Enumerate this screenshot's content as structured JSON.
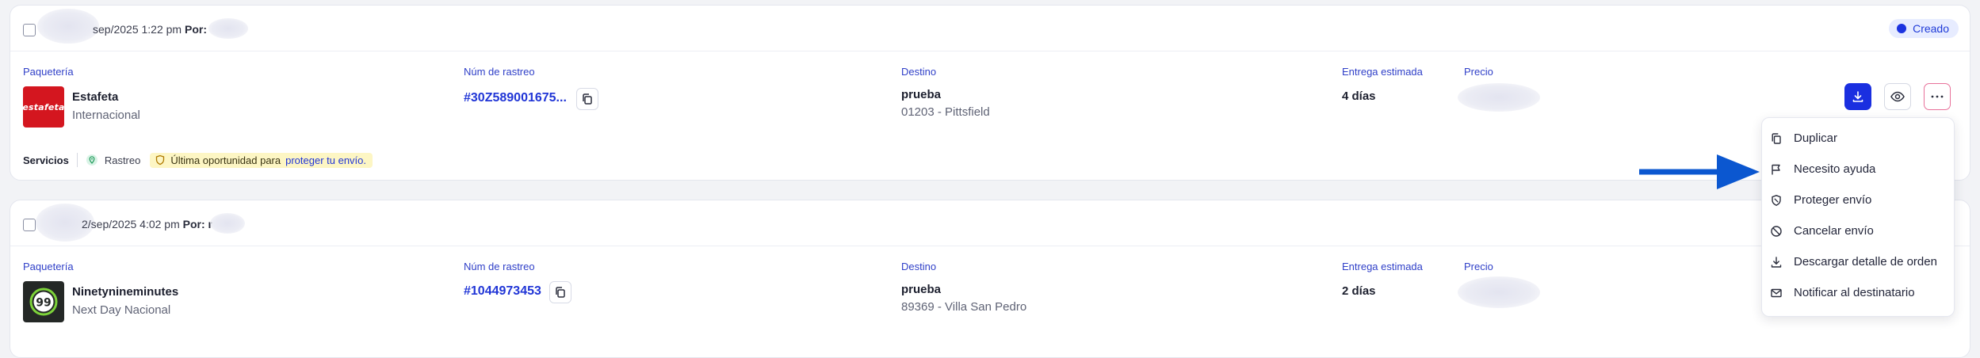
{
  "columns": {
    "carrier": "Paquetería",
    "tracking": "Núm de rastreo",
    "destination": "Destino",
    "estimated": "Entrega estimada",
    "price": "Precio"
  },
  "shipments": [
    {
      "header_date": "sep/2025 1:22 pm",
      "header_by": "Por:",
      "status": "Creado",
      "carrier_name": "Estafeta",
      "carrier_service": "Internacional",
      "carrier_logo_text": "estafeta",
      "tracking": "#30Z589001675...",
      "dest_name": "prueba",
      "dest_address": "01203 - Pittsfield",
      "estimated": "4 días",
      "services_label": "Servicios",
      "service_rastreo": "Rastreo",
      "promo_text": "Última oportunidad para",
      "promo_link": "proteger tu envío."
    },
    {
      "header_date": "2/sep/2025 4:02 pm",
      "header_by": "Por: r",
      "carrier_name": "Ninetynineminutes",
      "carrier_service": "Next Day Nacional",
      "carrier_logo_text": "99",
      "tracking": "#1044973453",
      "dest_name": "prueba",
      "dest_address": "89369 - Villa San Pedro",
      "estimated": "2 días"
    }
  ],
  "menu": {
    "items": [
      {
        "label": "Duplicar",
        "icon": "copy-icon"
      },
      {
        "label": "Necesito ayuda",
        "icon": "flag-icon"
      },
      {
        "label": "Proteger envío",
        "icon": "shield-icon"
      },
      {
        "label": "Cancelar envío",
        "icon": "cancel-icon"
      },
      {
        "label": "Descargar detalle de orden",
        "icon": "download-icon"
      },
      {
        "label": "Notificar al destinatario",
        "icon": "mail-icon"
      }
    ]
  },
  "colors": {
    "accent": "#1a2fe0",
    "status_badge_bg": "#e7ecff",
    "estafeta_red": "#d4161f",
    "promo_bg": "#fdf6c4",
    "arrow": "#0b57d0"
  }
}
